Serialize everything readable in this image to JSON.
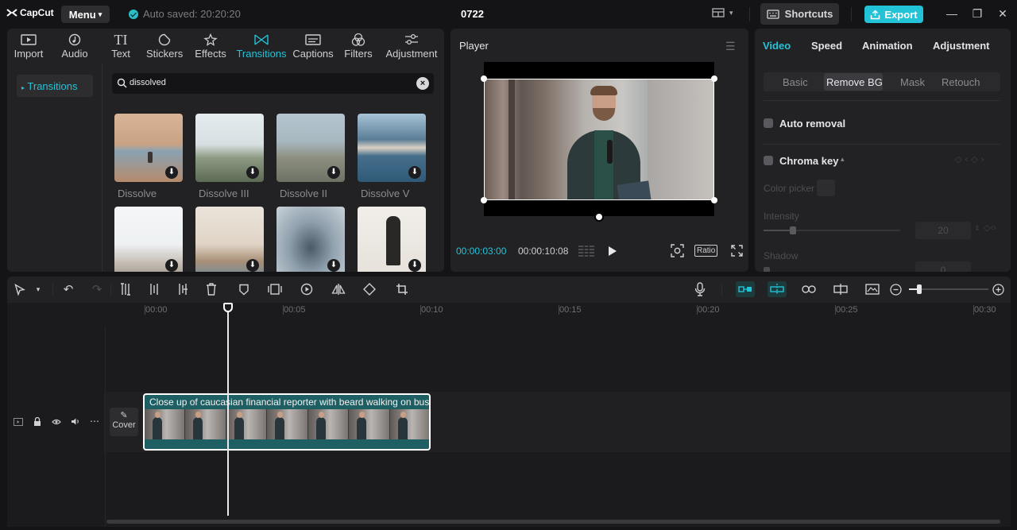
{
  "topbar": {
    "logo": "CapCut",
    "menu_label": "Menu",
    "autosave": "Auto saved: 20:20:20",
    "project_title": "0722",
    "shortcuts_label": "Shortcuts",
    "export_label": "Export"
  },
  "media": {
    "tabs": [
      {
        "label": "Import",
        "icon": "import-icon"
      },
      {
        "label": "Audio",
        "icon": "audio-icon"
      },
      {
        "label": "Text",
        "icon": "text-icon"
      },
      {
        "label": "Stickers",
        "icon": "stickers-icon"
      },
      {
        "label": "Effects",
        "icon": "effects-icon"
      },
      {
        "label": "Transitions",
        "icon": "transitions-icon"
      },
      {
        "label": "Captions",
        "icon": "captions-icon"
      },
      {
        "label": "Filters",
        "icon": "filters-icon"
      },
      {
        "label": "Adjustment",
        "icon": "adjustment-icon"
      }
    ],
    "active_tab": "Transitions",
    "sidebar_item": "Transitions",
    "search_value": "dissolved",
    "items": [
      {
        "label": "Dissolve"
      },
      {
        "label": "Dissolve III"
      },
      {
        "label": "Dissolve II"
      },
      {
        "label": "Dissolve V"
      }
    ]
  },
  "player": {
    "title": "Player",
    "current_time": "00:00:03:00",
    "total_time": "00:00:10:08",
    "ratio_label": "Ratio"
  },
  "props": {
    "tabs": [
      "Video",
      "Speed",
      "Animation",
      "Adjustment"
    ],
    "active_tab": "Video",
    "subtabs": [
      "Basic",
      "Remove BG",
      "Mask",
      "Retouch"
    ],
    "active_subtab": "Remove BG",
    "auto_removal": "Auto removal",
    "chroma_key": "Chroma key",
    "color_picker": "Color picker",
    "intensity": "Intensity",
    "intensity_value": "20",
    "shadow": "Shadow",
    "shadow_value": "0"
  },
  "timeline": {
    "ruler": [
      "00:00",
      "00:05",
      "00:10",
      "00:15",
      "00:20",
      "00:25",
      "00:30"
    ],
    "clip_title": "Close up of caucasian financial reporter with beard walking on bus",
    "cover_label": "Cover"
  },
  "colors": {
    "accent": "#22c3d6",
    "background": "#141416",
    "panel": "#222225",
    "clip": "#1e5f63"
  }
}
